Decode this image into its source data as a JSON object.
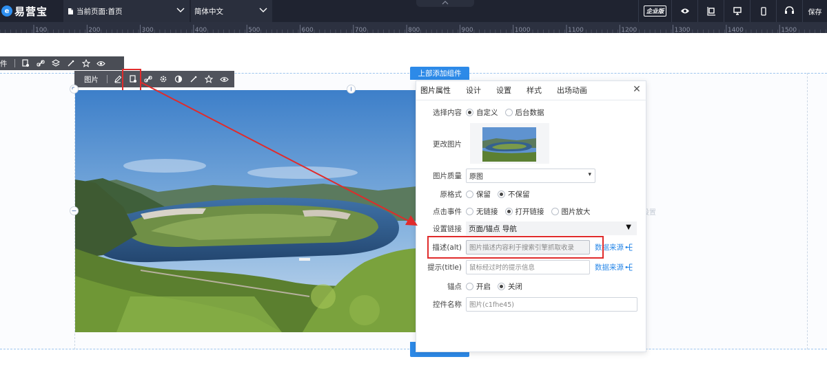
{
  "app": {
    "logo_mark": "e",
    "logo_text": "易营宝",
    "page_select_label": "当前页面:首页",
    "language_select_label": "简体中文",
    "edition_badge": "企业版",
    "save_label": "保存"
  },
  "ruler": {
    "ticks": [
      "100",
      "200",
      "300",
      "400",
      "500",
      "600",
      "700",
      "800",
      "900",
      "1000",
      "1100",
      "1200",
      "1300",
      "1400",
      "1500"
    ]
  },
  "canvas": {
    "add_top_label": "上部添加组件",
    "ghost_text": "设置"
  },
  "toolbars": {
    "back_label": "件",
    "front_label": "图片"
  },
  "panel": {
    "tabs": [
      "图片属性",
      "设计",
      "设置",
      "样式",
      "出场动画"
    ],
    "close_label": "✕",
    "content_source": {
      "label": "选择内容",
      "options": [
        "自定义",
        "后台数据"
      ],
      "selected": 0
    },
    "change_image_label": "更改图片",
    "quality": {
      "label": "图片质量",
      "value": "原图"
    },
    "original_format": {
      "label": "原格式",
      "options": [
        "保留",
        "不保留"
      ],
      "selected": 1
    },
    "click_event": {
      "label": "点击事件",
      "options": [
        "无链接",
        "打开链接",
        "图片放大"
      ],
      "selected": 1
    },
    "link": {
      "label": "设置链接",
      "value": "页面/锚点 导航"
    },
    "alt": {
      "label": "描述(alt)",
      "placeholder": "图片描述内容利于搜索引擎抓取收录",
      "data_source": "数据来源"
    },
    "title": {
      "label": "提示(title)",
      "placeholder": "鼠标经过时的提示信息",
      "data_source": "数据来源"
    },
    "anchor": {
      "label": "锚点",
      "options": [
        "开启",
        "关闭"
      ],
      "selected": 1
    },
    "control_name": {
      "label": "控件名称",
      "placeholder": "图片(c1fhe45)"
    }
  },
  "colors": {
    "topbar": "#1f2330",
    "accent": "#2d8ae8",
    "highlight": "#e02b2b"
  }
}
